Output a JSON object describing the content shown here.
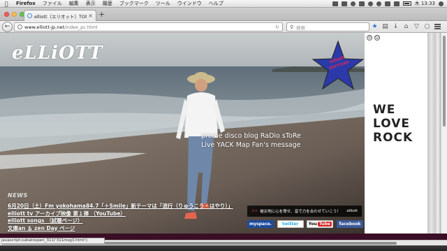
{
  "menubar": {
    "apple": "",
    "app": "Firefox",
    "items": [
      "ファイル",
      "編集",
      "表示",
      "履歴",
      "ブックマーク",
      "ツール",
      "ウインドウ",
      "ヘルプ"
    ],
    "clock": "木 13:33"
  },
  "tab": {
    "title": "elliott（エリオット）TOM...",
    "close": "×",
    "new_tab": "+"
  },
  "nav": {
    "back": "←",
    "url_host": "www.elliott-jp.net",
    "url_path": "/index_pc.html",
    "search_placeholder": "検索",
    "search_icon": "search-icon"
  },
  "hero": {
    "logo": "eLLiOTT",
    "badge": "elliott\nsarrisan",
    "nav_line1": "prome disco blog RaDio sToRe",
    "nav_line2": "Live YACK Map Fan's message",
    "news_heading": "NEWS",
    "news": [
      "6月20日（土）Fm yokohama84.7「＋Smile」新テーマは「流行（りゅうこう・はやり）」",
      "elliott tv アーカイブ映像 第１弾 （YouTube）",
      "elliott songs （試聴ページ）",
      "文庫an ＆ zen Day ページ"
    ],
    "promo_text": "被災地に心を寄せ、音で力を合わせていこう！",
    "promo_brand": "elliott",
    "social": {
      "myspace": "myspace.",
      "twitter": "twitter",
      "youtube_a": "You",
      "youtube_b": "Tube",
      "facebook": "facebook"
    }
  },
  "side": {
    "welove": [
      "WE",
      "LOVE",
      "ROCK"
    ]
  },
  "status": {
    "text": "javascript:subwinopen_311('311msg3.html');"
  },
  "colors": {
    "badge_star": "#2b3aa8",
    "badge_text": "#d8285d",
    "bottom_bar": "#3a0f25"
  }
}
